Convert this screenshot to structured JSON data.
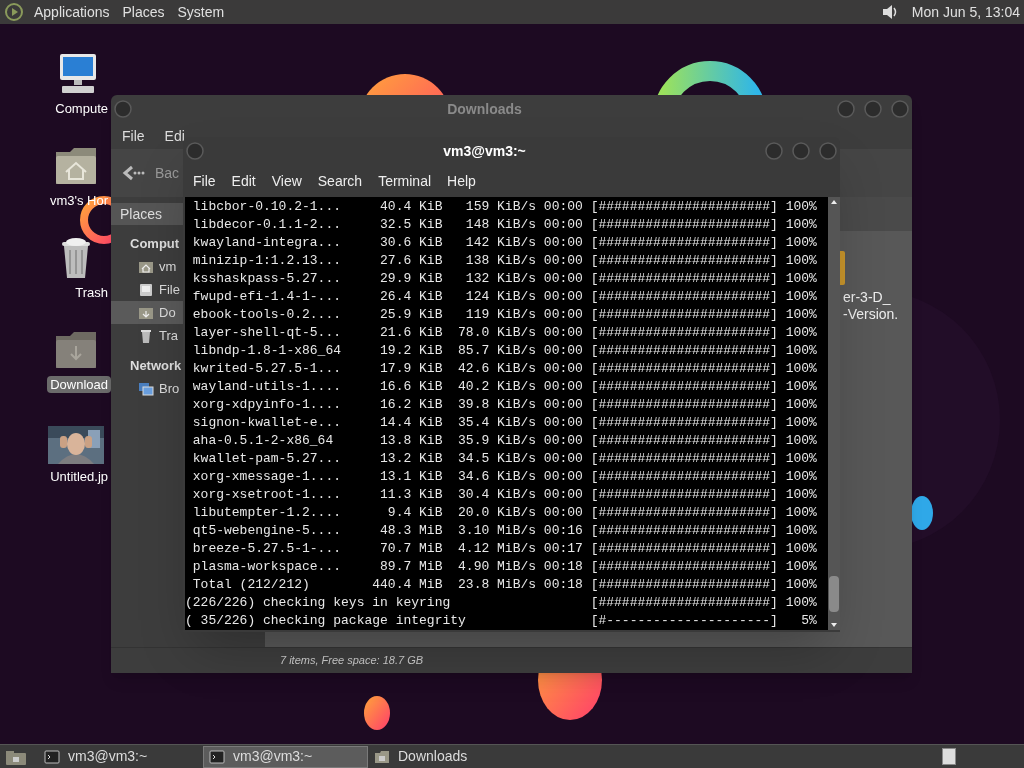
{
  "top_panel": {
    "menus": [
      "Applications",
      "Places",
      "System"
    ],
    "clock": "Mon Jun 5, 13:04"
  },
  "desktop_icons": [
    {
      "kind": "computer",
      "label": "Compute",
      "selected": false
    },
    {
      "kind": "home",
      "label": "vm3's Hor",
      "selected": false
    },
    {
      "kind": "trash",
      "label": "Trash",
      "selected": false
    },
    {
      "kind": "folder",
      "label": "Download",
      "selected": true
    },
    {
      "label": "Untitled.jp",
      "selected": false
    }
  ],
  "file_manager": {
    "title": "Downloads",
    "menus": [
      "File",
      "Edi"
    ],
    "back_button": "Bac",
    "sidebar": {
      "header": "Places",
      "sections": [
        {
          "title": "Comput",
          "items": [
            {
              "kind": "home",
              "label": "vm",
              "selected": false
            },
            {
              "kind": "drive",
              "label": "File",
              "selected": false
            },
            {
              "kind": "downloads",
              "label": "Do",
              "selected": true
            },
            {
              "kind": "trash",
              "label": "Tra",
              "selected": false
            }
          ]
        },
        {
          "title": "Network",
          "items": [
            {
              "kind": "network",
              "label": "Bro",
              "selected": false
            }
          ]
        }
      ]
    },
    "file_label_lines": [
      "er-3-D_",
      "-Version."
    ],
    "status": "7 items, Free space: 18.7 GB"
  },
  "terminal": {
    "title": "vm3@vm3:~",
    "menus": [
      "File",
      "Edit",
      "View",
      "Search",
      "Terminal",
      "Help"
    ],
    "lines": [
      " libcbor-0.10.2-1...     40.4 KiB   159 KiB/s 00:00 [######################] 100%",
      " libdecor-0.1.1-2...     32.5 KiB   148 KiB/s 00:00 [######################] 100%",
      " kwayland-integra...     30.6 KiB   142 KiB/s 00:00 [######################] 100%",
      " minizip-1:1.2.13...     27.6 KiB   138 KiB/s 00:00 [######################] 100%",
      " ksshaskpass-5.27...     29.9 KiB   132 KiB/s 00:00 [######################] 100%",
      " fwupd-efi-1.4-1-...     26.4 KiB   124 KiB/s 00:00 [######################] 100%",
      " ebook-tools-0.2....     25.9 KiB   119 KiB/s 00:00 [######################] 100%",
      " layer-shell-qt-5...     21.6 KiB  78.0 KiB/s 00:00 [######################] 100%",
      " libndp-1.8-1-x86_64     19.2 KiB  85.7 KiB/s 00:00 [######################] 100%",
      " kwrited-5.27.5-1...     17.9 KiB  42.6 KiB/s 00:00 [######################] 100%",
      " wayland-utils-1....     16.6 KiB  40.2 KiB/s 00:00 [######################] 100%",
      " xorg-xdpyinfo-1....     16.2 KiB  39.8 KiB/s 00:00 [######################] 100%",
      " signon-kwallet-e...     14.4 KiB  35.4 KiB/s 00:00 [######################] 100%",
      " aha-0.5.1-2-x86_64      13.8 KiB  35.9 KiB/s 00:00 [######################] 100%",
      " kwallet-pam-5.27...     13.2 KiB  34.5 KiB/s 00:00 [######################] 100%",
      " xorg-xmessage-1....     13.1 KiB  34.6 KiB/s 00:00 [######################] 100%",
      " xorg-xsetroot-1....     11.3 KiB  30.4 KiB/s 00:00 [######################] 100%",
      " libutempter-1.2....      9.4 KiB  20.0 KiB/s 00:00 [######################] 100%",
      " qt5-webengine-5....     48.3 MiB  3.10 MiB/s 00:16 [######################] 100%",
      " breeze-5.27.5-1-...     70.7 MiB  4.12 MiB/s 00:17 [######################] 100%",
      " plasma-workspace...     89.7 MiB  4.90 MiB/s 00:18 [######################] 100%",
      " Total (212/212)        440.4 MiB  23.8 MiB/s 00:18 [######################] 100%",
      "(226/226) checking keys in keyring                  [######################] 100%",
      "( 35/226) checking package integrity                [#---------------------]   5%"
    ]
  },
  "taskbar": {
    "tasks": [
      {
        "kind": "terminal",
        "label": "vm3@vm3:~",
        "selected": false
      },
      {
        "kind": "terminal",
        "label": "vm3@vm3:~",
        "selected": true
      },
      {
        "kind": "folder",
        "label": "Downloads",
        "selected": false
      }
    ]
  }
}
